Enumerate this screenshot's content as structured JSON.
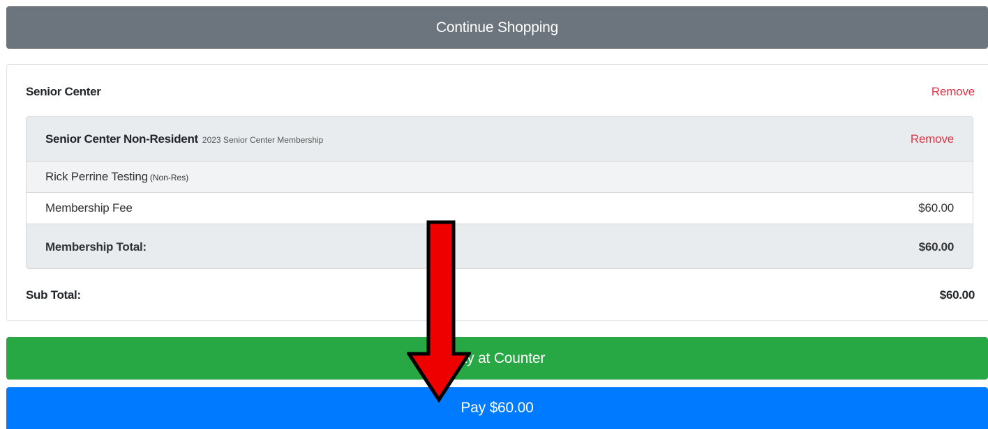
{
  "buttons": {
    "continue_shopping": "Continue Shopping",
    "pay_at_counter": "Pay at Counter",
    "pay_online": "Pay $60.00"
  },
  "cart": {
    "section_title": "Senior Center",
    "section_remove": "Remove",
    "item": {
      "name": "Senior Center Non-Resident",
      "description": "2023 Senior Center Membership",
      "remove": "Remove"
    },
    "participant": {
      "name": "Rick Perrine Testing",
      "tag": "(Non-Res)"
    },
    "fee": {
      "label": "Membership Fee",
      "amount": "$60.00"
    },
    "item_total": {
      "label": "Membership Total:",
      "amount": "$60.00"
    },
    "subtotal": {
      "label": "Sub Total:",
      "amount": "$60.00"
    }
  },
  "colors": {
    "continue_button": "#6c757d",
    "counter_button": "#28a745",
    "pay_button": "#007bff",
    "remove_link": "#dc3545",
    "annotation_arrow": "#ee0000"
  },
  "annotation": {
    "icon": "down-arrow-icon"
  }
}
